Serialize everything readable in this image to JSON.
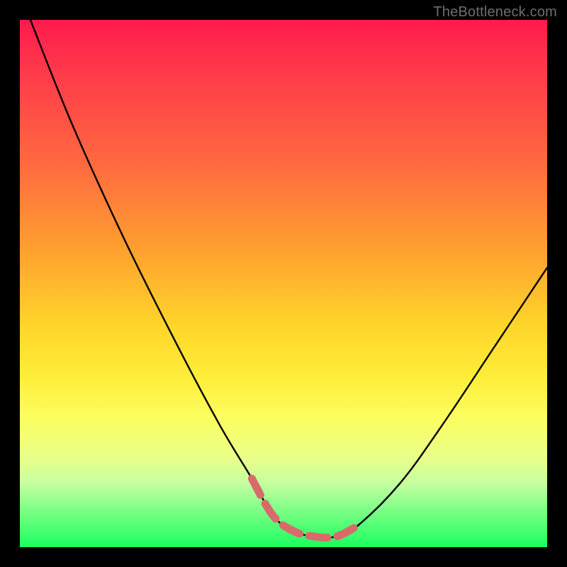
{
  "watermark": "TheBottleneck.com",
  "colors": {
    "frame": "#000000",
    "curve_stroke": "#000000",
    "accent_stroke": "#d86a6a",
    "gradient_stops": [
      "#ff1a4d",
      "#ff3a4a",
      "#ff6b3f",
      "#ffa52e",
      "#ffd52a",
      "#ffee3a",
      "#fbff63",
      "#eaff8a",
      "#c4ffa0",
      "#7dff86",
      "#1aff5e"
    ]
  },
  "chart_data": {
    "type": "line",
    "title": "",
    "xlabel": "",
    "ylabel": "",
    "xlim": [
      0,
      100
    ],
    "ylim": [
      0,
      100
    ],
    "grid": false,
    "legend": false,
    "series": [
      {
        "name": "curve",
        "x": [
          2,
          10,
          20,
          30,
          38,
          44,
          48,
          52,
          56,
          60,
          64,
          72,
          80,
          90,
          100
        ],
        "y": [
          100,
          80,
          58,
          38,
          23,
          13,
          6,
          3,
          2,
          2,
          4,
          12,
          23,
          38,
          53
        ]
      },
      {
        "name": "bottom-accent",
        "x": [
          44,
          48,
          52,
          56,
          60,
          64
        ],
        "y": [
          13,
          6,
          3,
          2,
          2,
          4
        ]
      }
    ],
    "annotations": []
  }
}
